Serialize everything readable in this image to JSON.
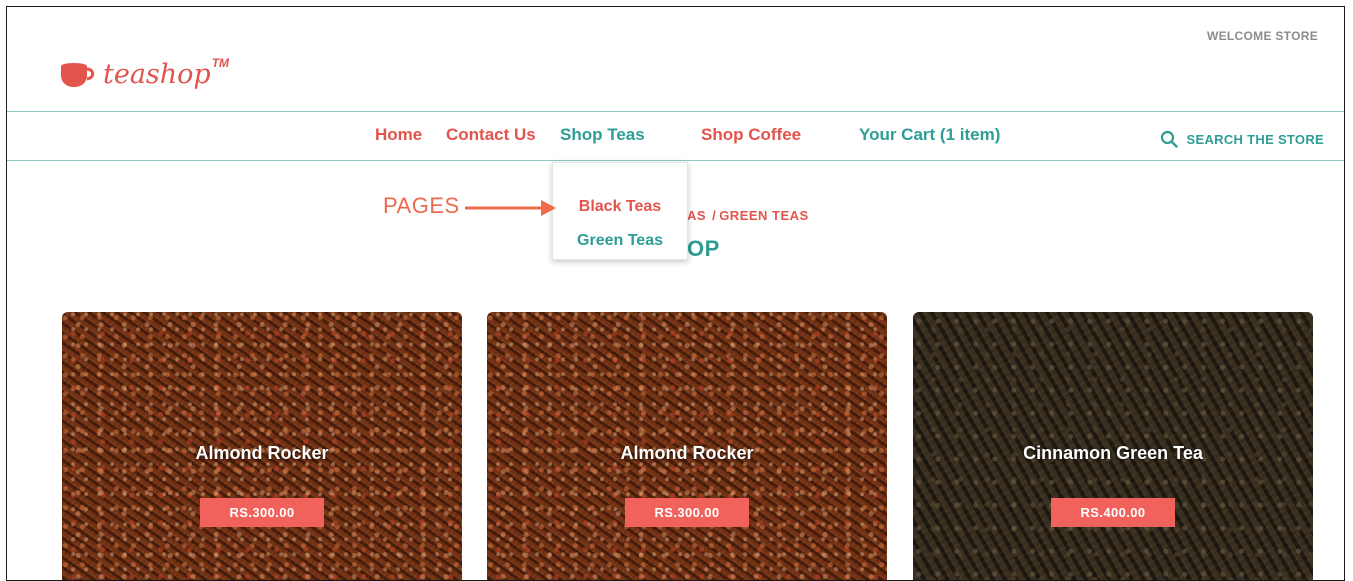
{
  "header": {
    "welcome": "WELCOME STORE",
    "logo_text": "teashop",
    "logo_tm": "TM",
    "brand_color": "#e2544c",
    "accent_color": "#2e9d95"
  },
  "nav": {
    "home": "Home",
    "contact": "Contact Us",
    "shop_teas": "Shop Teas",
    "shop_coffee": "Shop Coffee",
    "cart": "Your Cart (1 item)",
    "search": "SEARCH THE STORE",
    "search_icon": "search-icon"
  },
  "dropdown": {
    "items": [
      "Black Teas",
      "Green Teas"
    ]
  },
  "annotation": {
    "label": "PAGES",
    "arrow_icon": "arrow-right-icon"
  },
  "breadcrumb": {
    "visible_part": "AS",
    "separator": "/",
    "current": "GREEN TEAS"
  },
  "heading": {
    "visible_part": "OP"
  },
  "products": [
    {
      "name": "Almond Rocker",
      "price": "RS.300.00"
    },
    {
      "name": "Almond Rocker",
      "price": "RS.300.00"
    },
    {
      "name": "Cinnamon Green Tea",
      "price": "RS.400.00"
    }
  ]
}
